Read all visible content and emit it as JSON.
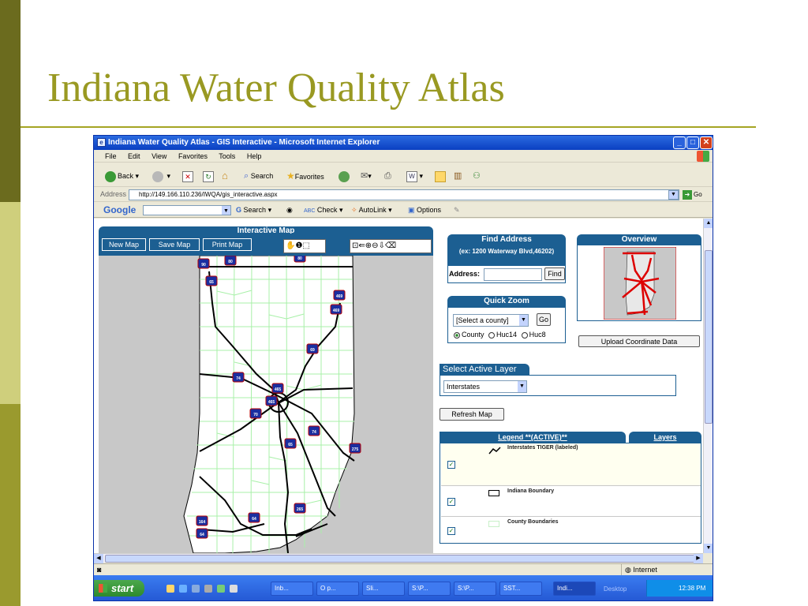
{
  "slide": {
    "title": "Indiana Water Quality Atlas"
  },
  "window": {
    "title": "Indiana Water Quality Atlas - GIS Interactive - Microsoft Internet Explorer",
    "menu": [
      "File",
      "Edit",
      "View",
      "Favorites",
      "Tools",
      "Help"
    ],
    "toolbar": {
      "back": "Back",
      "search": "Search",
      "favorites": "Favorites"
    },
    "address_label": "Address",
    "url": "http://149.166.110.236/IWQA/gis_interactive.aspx",
    "go_label": "Go",
    "google": {
      "logo": "Google",
      "search": "Search",
      "check": "Check",
      "autolink": "AutoLink",
      "options": "Options"
    },
    "status": {
      "zone": "Internet"
    }
  },
  "map_panel": {
    "title": "Interactive Map",
    "buttons": [
      "New Map",
      "Save Map",
      "Print Map"
    ]
  },
  "interstate_shields": [
    "90",
    "80",
    "80",
    "65",
    "469",
    "469",
    "69",
    "74",
    "465",
    "465",
    "70",
    "74",
    "65",
    "275",
    "265",
    "64",
    "164",
    "64"
  ],
  "find_address": {
    "title": "Find Address",
    "example": "(ex: 1200 Waterway Blvd,46202)",
    "address_label": "Address:",
    "address_value": "",
    "find_button": "Find"
  },
  "overview": {
    "title": "Overview",
    "upload_button": "Upload Coordinate Data"
  },
  "quick_zoom": {
    "title": "Quick Zoom",
    "select_value": "[Select a county]",
    "go_button": "Go",
    "options": [
      "County",
      "Huc14",
      "Huc8"
    ],
    "selected": "County"
  },
  "active_layer": {
    "title": "Select Active Layer",
    "value": "Interstates",
    "refresh_button": "Refresh Map"
  },
  "legend": {
    "tab": "Legend **(ACTIVE)**",
    "layers_tab": "Layers",
    "items": [
      {
        "label": "Interstates TIGER (labeled)",
        "checked": true
      },
      {
        "label": "Indiana Boundary",
        "checked": true
      },
      {
        "label": "County Boundaries",
        "checked": true
      }
    ]
  },
  "taskbar": {
    "start": "start",
    "tasks": [
      "Inb...",
      "O p...",
      "Sli...",
      "S:\\P...",
      "S:\\P...",
      "SST...",
      "Indi..."
    ],
    "active_task": "Indi...",
    "desktop": "Desktop",
    "clock": "12:38 PM"
  },
  "colors": {
    "title": "#999922",
    "panel": "#1c5f92",
    "county_lines": "#a8f0a8",
    "overview_route": "#dd0000"
  }
}
